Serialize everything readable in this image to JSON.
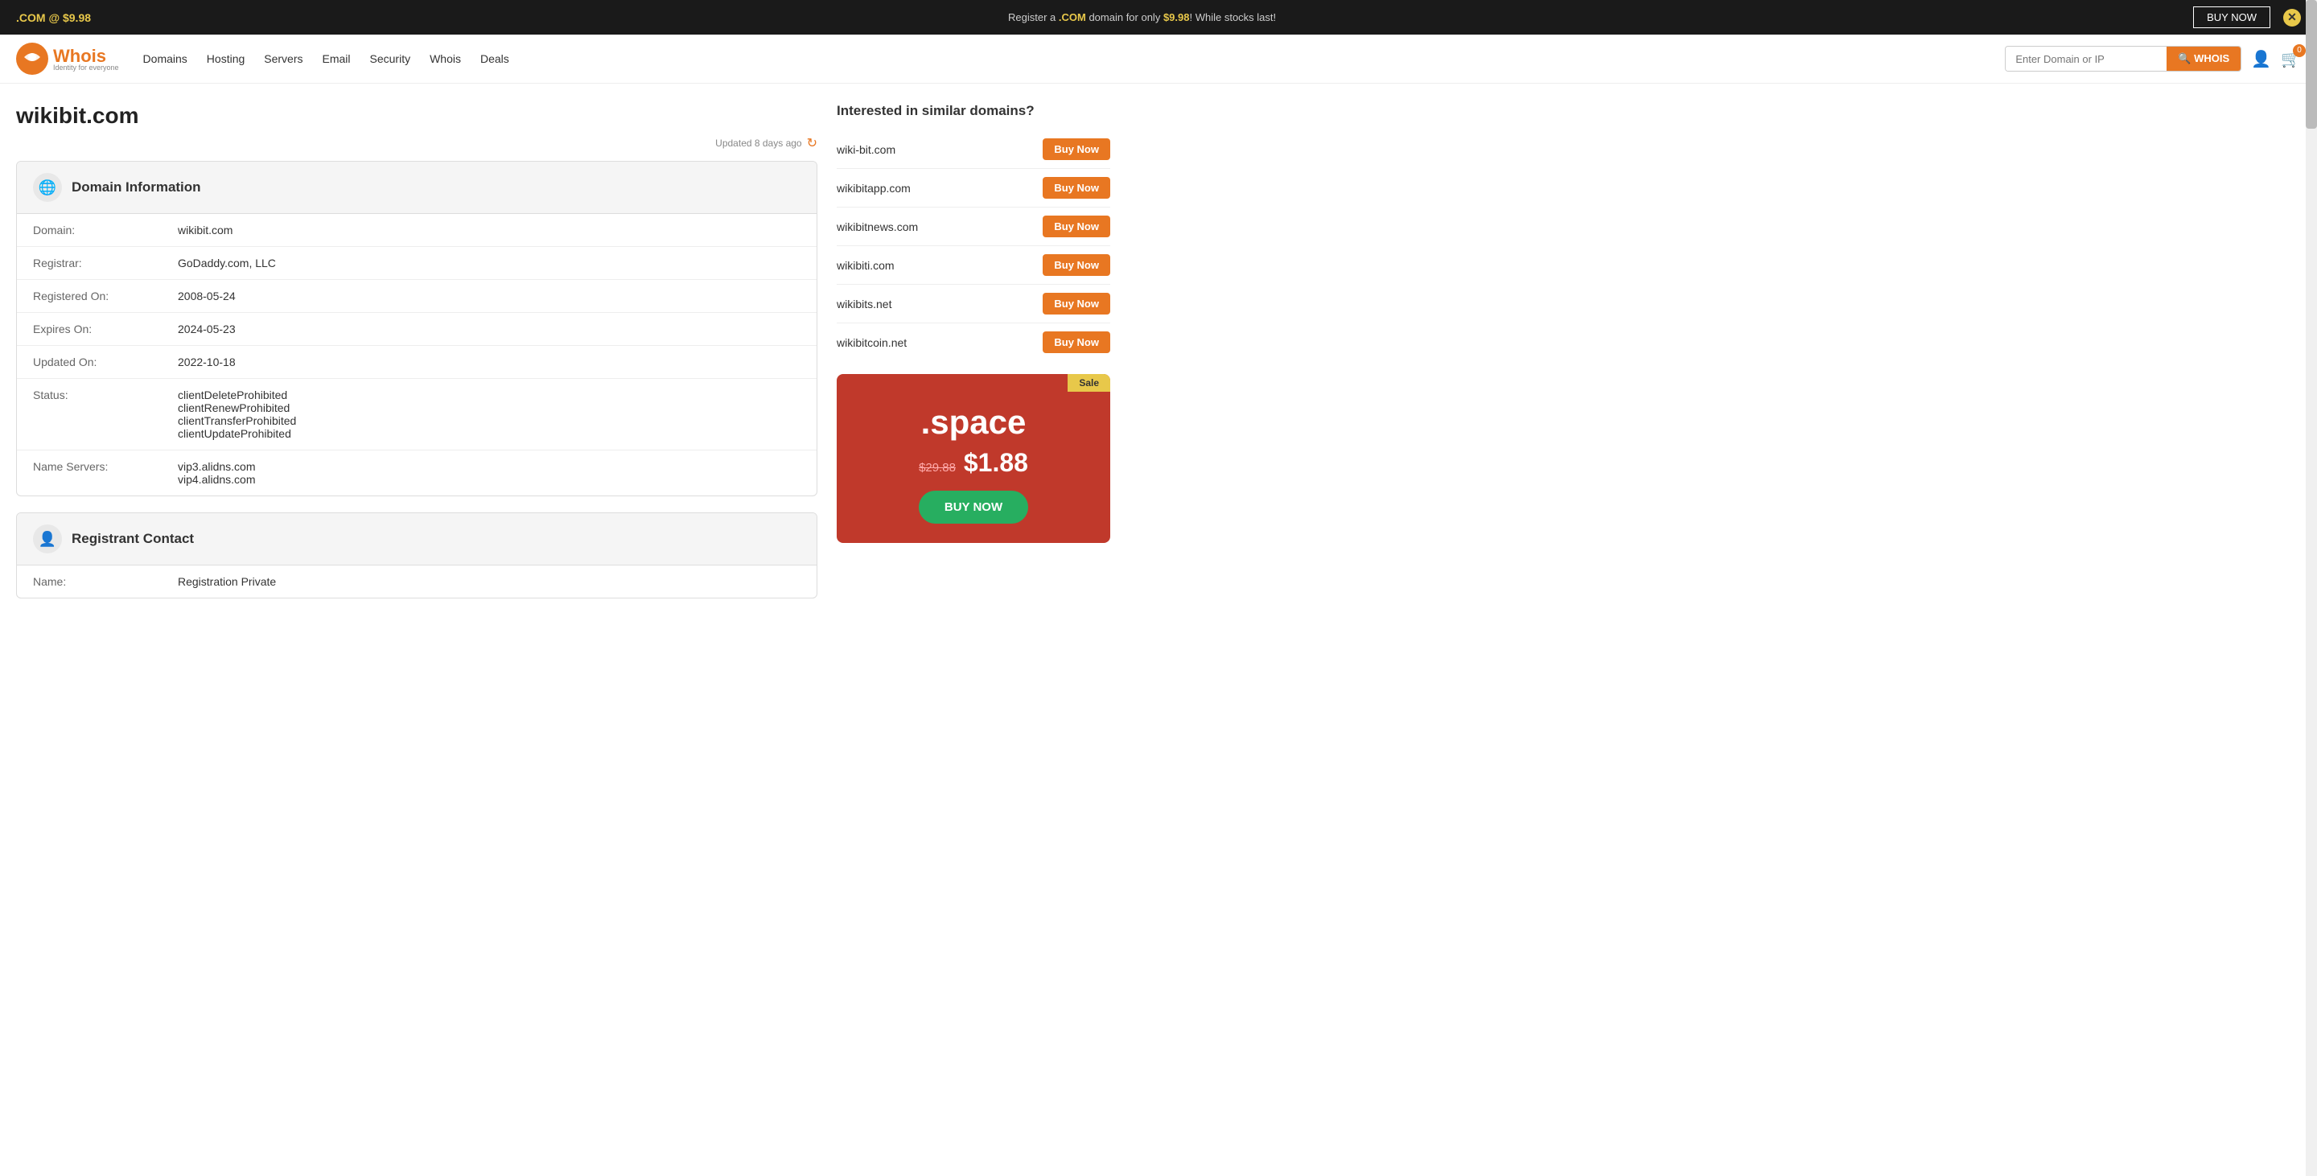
{
  "banner": {
    "left_text": ".COM @ $9.98",
    "center_text_pre": "Register a ",
    "center_highlight": ".COM",
    "center_text_post": " domain for only ",
    "price_highlight": "$9.98",
    "center_text_end": "! While stocks last!",
    "buy_now_label": "BUY NOW",
    "close_symbol": "✕"
  },
  "navbar": {
    "logo_text": "Whois",
    "logo_tagline": "Identity for everyone",
    "links": [
      {
        "label": "Domains",
        "name": "nav-domains"
      },
      {
        "label": "Hosting",
        "name": "nav-hosting"
      },
      {
        "label": "Servers",
        "name": "nav-servers"
      },
      {
        "label": "Email",
        "name": "nav-email"
      },
      {
        "label": "Security",
        "name": "nav-security"
      },
      {
        "label": "Whois",
        "name": "nav-whois"
      },
      {
        "label": "Deals",
        "name": "nav-deals"
      }
    ],
    "search_placeholder": "Enter Domain or IP",
    "search_button_label": "WHOIS",
    "cart_count": "0"
  },
  "page": {
    "title": "wikibit.com",
    "updated_text": "Updated 8 days ago"
  },
  "domain_info": {
    "section_title": "Domain Information",
    "fields": [
      {
        "label": "Domain:",
        "value": "wikibit.com"
      },
      {
        "label": "Registrar:",
        "value": "GoDaddy.com, LLC"
      },
      {
        "label": "Registered On:",
        "value": "2008-05-24"
      },
      {
        "label": "Expires On:",
        "value": "2024-05-23"
      },
      {
        "label": "Updated On:",
        "value": "2022-10-18"
      },
      {
        "label": "Status:",
        "value": "clientDeleteProhibited\nclientRenewProhibited\nclientTransferProhibited\nclientUpdateProhibited"
      },
      {
        "label": "Name Servers:",
        "value": "vip3.alidns.com\nvip4.alidns.com"
      }
    ]
  },
  "registrant_contact": {
    "section_title": "Registrant Contact",
    "fields": [
      {
        "label": "Name:",
        "value": "Registration Private"
      }
    ]
  },
  "similar_domains": {
    "title": "Interested in similar domains?",
    "domains": [
      {
        "name": "wiki-bit.com",
        "btn": "Buy Now"
      },
      {
        "name": "wikibitapp.com",
        "btn": "Buy Now"
      },
      {
        "name": "wikibitnews.com",
        "btn": "Buy Now"
      },
      {
        "name": "wikibiti.com",
        "btn": "Buy Now"
      },
      {
        "name": "wikibits.net",
        "btn": "Buy Now"
      },
      {
        "name": "wikibitcoin.net",
        "btn": "Buy Now"
      }
    ]
  },
  "sale_card": {
    "badge": "Sale",
    "extension": ".space",
    "old_price": "$29.88",
    "new_price": "$1.88",
    "buy_btn_label": "BUY NOW"
  }
}
